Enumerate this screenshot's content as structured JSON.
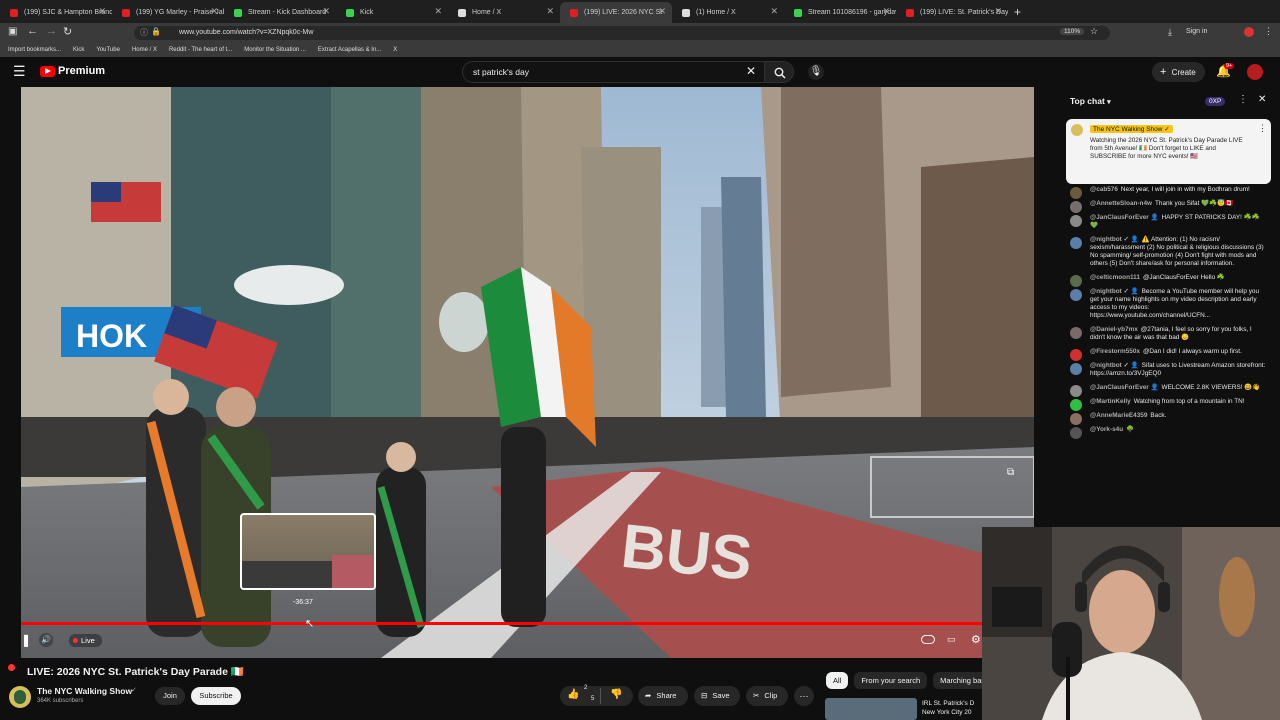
{
  "browser": {
    "tabs": [
      {
        "label": "(199) SJC & Hampton Brandon",
        "color": "#e02020"
      },
      {
        "label": "(199) YG Marley - Praise Jah In",
        "color": "#e02020"
      },
      {
        "label": "Stream - Kick Dashboard",
        "color": "#39d353"
      },
      {
        "label": "Kick",
        "color": "#39d353"
      },
      {
        "label": "Home / X",
        "color": "#dddddd"
      },
      {
        "label": "(199) LIVE: 2026 NYC St",
        "color": "#e02020",
        "active": true
      },
      {
        "label": "(1) Home / X",
        "color": "#dddddd"
      },
      {
        "label": "Stream 101086196 - garydavid",
        "color": "#39d353"
      },
      {
        "label": "(199) LIVE: St. Patrick's Day pa",
        "color": "#e02020"
      }
    ],
    "new_tab": "+",
    "url": "www.youtube.com/watch?v=XZNpqk0c-Mw",
    "zoom": "110%",
    "sign_in": "Sign in",
    "bookmarks": [
      "Import bookmarks...",
      "Kick",
      "YouTube",
      "Home / X",
      "Reddit - The heart of t...",
      "Monitor the Situation ...",
      "Extract Acapellas & In...",
      "X"
    ]
  },
  "youtube": {
    "logo_text": "Premium",
    "search_value": "st patrick's day",
    "create_label": "Create",
    "notif_count": "9+"
  },
  "player": {
    "hover_time": "-36:37",
    "live_label": "Live",
    "progress_fraction": 0.995
  },
  "video_info": {
    "title": "LIVE: 2026 NYC St. Patrick's Day Parade 🇮🇪",
    "channel": "The NYC Walking Show",
    "subscribers": "364K subscribers",
    "join": "Join",
    "subscribe": "Subscribe",
    "likes": "2",
    "dislikes": "5",
    "share": "Share",
    "save": "Save",
    "clip": "Clip",
    "more": "⋯"
  },
  "filters": [
    "All",
    "From your search",
    "Marching bar"
  ],
  "recommendation": {
    "title": "IRL St. Patrick's D New York City 20"
  },
  "chat": {
    "mode": "Top chat",
    "points": "0XP",
    "pinned": {
      "author": "The NYC Walking Show ✓",
      "text": "Watching the 2026 NYC St. Patrick's Day Parade LIVE from 5th Avenue! 🇮🇪 Don't forget to LIKE and SUBSCRIBE for more NYC events! 🇺🇸"
    },
    "messages": [
      {
        "author": "@cab576",
        "text": "Next year, I will join in with my Bodhran drum!",
        "color": "#6b5a3d"
      },
      {
        "author": "@AnnetteSloan-n4w",
        "text": "Thank you Sifat 💚☘️😇🇨🇦",
        "color": "#7a6d6d"
      },
      {
        "author": "@JanClausForEver 👤",
        "text": "HAPPY ST PATRICKS DAY! ☘️☘️💚",
        "color": "#8a8a8a"
      },
      {
        "author": "@nightbot ✓ 👤",
        "text": "⚠️ Attention: (1) No racism/ sexism/harassment (2) No political & religious discussions (3) No spamming/ self-promotion (4) Don't fight with mods and others (5) Don't share/ask for personal information.",
        "color": "#5b7fa8"
      },
      {
        "author": "@celticmoon111",
        "text": "@JanClausForEver Hello ☘️",
        "color": "#5a6b4d"
      },
      {
        "author": "@nightbot ✓ 👤",
        "text": "Become a YouTube member will help you get your name highlights on my video description and early access to my videos: https://www.youtube.com/channel/UCFN...",
        "color": "#5b7fa8"
      },
      {
        "author": "@Daniel-yb7mx",
        "text": "@27tania, I feel so sorry for you folks, I didn't know the air was that bad 😔",
        "color": "#7a6a6a"
      },
      {
        "author": "@Firestorm550x",
        "text": "@Dan I did! I always warm up first.",
        "color": "#d03030"
      },
      {
        "author": "@nightbot ✓ 👤",
        "text": "Sifat uses to Livestream Amazon storefront: https://amzn.to/3VJgEQ0",
        "color": "#5b7fa8"
      },
      {
        "author": "@JanClausForEver 👤",
        "text": "WELCOME 2.8K VIEWERS! 😃👋",
        "color": "#8a8a8a"
      },
      {
        "author": "@MartinKelly",
        "text": "Watching from top of a mountain in TN!",
        "color": "#30c040"
      },
      {
        "author": "@AnneMarieE4359",
        "text": "Back.",
        "color": "#8a7060"
      },
      {
        "author": "@York-s4u",
        "text": "🌳",
        "color": "#555"
      }
    ]
  }
}
